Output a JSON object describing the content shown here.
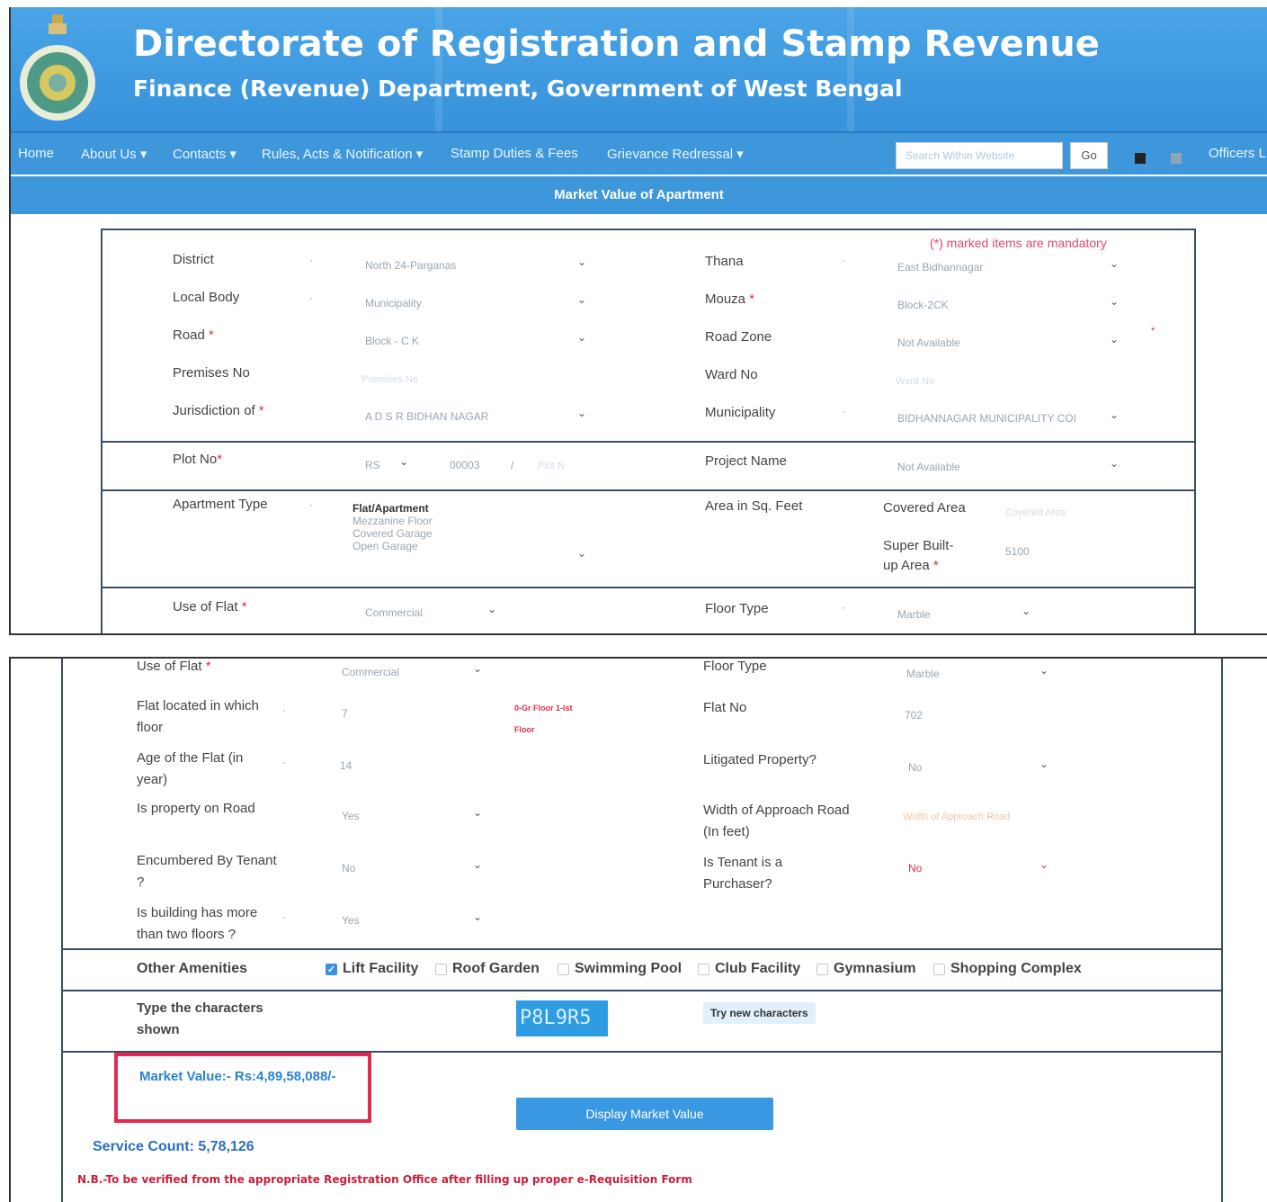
{
  "header": {
    "title": "Directorate of Registration and Stamp Revenue",
    "subtitle": "Finance (Revenue) Department, Government of West Bengal"
  },
  "nav": {
    "items": [
      "Home",
      "About Us ▾",
      "Contacts ▾",
      "Rules, Acts & Notification ▾",
      "Stamp Duties & Fees",
      "Grievance Redressal ▾"
    ],
    "search_placeholder": "Search Within Website",
    "go_label": "Go",
    "officers_label": "Officers L"
  },
  "section_title": "Market Value of Apartment",
  "mandatory_note": "(*) marked items are mandatory",
  "form1": {
    "district": {
      "label": "District",
      "value": "North 24-Parganas"
    },
    "thana": {
      "label": "Thana",
      "value": "East Bidhannagar"
    },
    "local_body": {
      "label": "Local Body",
      "value": "Municipality"
    },
    "mouza": {
      "label": "Mouza",
      "value": "Block-2CK"
    },
    "road": {
      "label": "Road",
      "value": "Block - C K"
    },
    "road_zone": {
      "label": "Road Zone",
      "value": "Not Available"
    },
    "premises_no": {
      "label": "Premises No",
      "placeholder": "Premises No"
    },
    "ward_no": {
      "label": "Ward No",
      "placeholder": "Ward No"
    },
    "jurisdiction": {
      "label": "Jurisdiction of",
      "value": "A D S R BIDHAN NAGAR"
    },
    "municipality": {
      "label": "Municipality",
      "value": "BIDHANNAGAR MUNICIPALITY COI"
    },
    "plot_no": {
      "label": "Plot No",
      "prefix": "RS",
      "value": "00003",
      "sep": "/",
      "placeholder": "Plot N"
    },
    "project_name": {
      "label": "Project Name",
      "value": "Not Available"
    },
    "apartment_type": {
      "label": "Apartment Type",
      "options": [
        "Flat/Apartment",
        "Mezzanine Floor",
        "Covered Garage",
        "Open Garage"
      ]
    },
    "area": {
      "label": "Area in Sq. Feet",
      "covered_label": "Covered Area",
      "covered_placeholder": "Covered Area",
      "super_label_1": "Super Built-",
      "super_label_2": "up Area",
      "super_value": "5100"
    },
    "use_of_flat": {
      "label": "Use of Flat",
      "value": "Commercial"
    },
    "floor_type": {
      "label": "Floor Type",
      "value": "Marble"
    }
  },
  "form2": {
    "use_of_flat": {
      "label": "Use of Flat",
      "value": "Commercial"
    },
    "floor_type": {
      "label": "Floor Type",
      "value": "Marble"
    },
    "flat_floor": {
      "label_1": "Flat located in which",
      "label_2": "floor",
      "value": "7",
      "hint_1": "0-Gr Floor 1-Ist",
      "hint_2": "Floor"
    },
    "flat_no": {
      "label": "Flat No",
      "value": "702"
    },
    "age": {
      "label_1": "Age of the Flat (in",
      "label_2": "year)",
      "value": "14"
    },
    "litigated": {
      "label": "Litigated Property?",
      "value": "No"
    },
    "on_road": {
      "label": "Is property on Road",
      "value": "Yes"
    },
    "approach_road": {
      "label_1": "Width of Approach Road",
      "label_2": "(In feet)",
      "placeholder": "Width of Approach Road"
    },
    "tenant": {
      "label_1": "Encumbered By Tenant",
      "label_2": "?",
      "value": "No"
    },
    "tenant_purchaser": {
      "label_1": "Is Tenant is a",
      "label_2": "Purchaser?",
      "value": "No"
    },
    "two_floors": {
      "label_1": "Is building has more",
      "label_2": "than two floors ?",
      "value": "Yes"
    },
    "amenities_label": "Other Amenities",
    "amenities": [
      {
        "label": "Lift Facility",
        "checked": true
      },
      {
        "label": "Roof Garden",
        "checked": false
      },
      {
        "label": "Swimming Pool",
        "checked": false
      },
      {
        "label": "Club Facility",
        "checked": false
      },
      {
        "label": "Gymnasium",
        "checked": false
      },
      {
        "label": "Shopping Complex",
        "checked": false
      }
    ],
    "captcha_label_1": "Type the characters",
    "captcha_label_2": "shown",
    "captcha_text": "P8L9R5",
    "try_new": "Try new characters",
    "market_value": "Market Value:- Rs:4,89,58,088/-",
    "display_button": "Display Market Value",
    "service_count": "Service Count: 5,78,126",
    "note": "N.B.-To be verified from the appropriate Registration Office after filling up proper e-Requisition Form"
  },
  "required_mark": "*",
  "checkmark": "✓",
  "chevron": "⌄",
  "colors": {
    "brand_blue": "#3f97db",
    "required_red": "#e0304a",
    "highlight_red": "#e4284f",
    "value_blue": "#2b82d9"
  }
}
